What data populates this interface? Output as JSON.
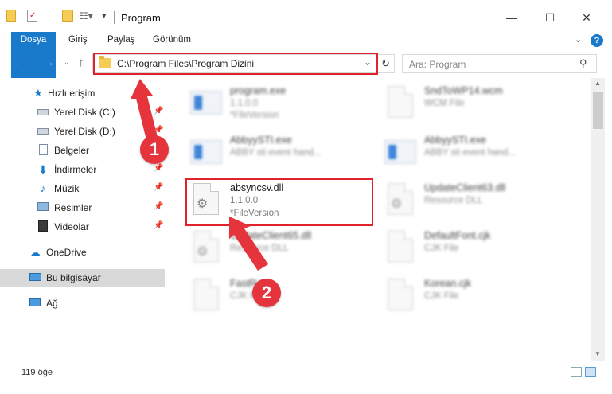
{
  "window": {
    "title": "Program",
    "buttons": {
      "minimize": "—",
      "maximize": "☐",
      "close": "✕"
    }
  },
  "ribbon": {
    "tabs": [
      "Dosya",
      "Giriş",
      "Paylaş",
      "Görünüm"
    ],
    "help": "?"
  },
  "address": {
    "path": "C:\\Program Files\\Program Dizini",
    "search_placeholder": "Ara: Program"
  },
  "sidebar": {
    "quick_access": "Hızlı erişim",
    "items": [
      {
        "label": "Yerel Disk (C:)",
        "icon": "drive-icon",
        "pinned": true
      },
      {
        "label": "Yerel Disk (D:)",
        "icon": "drive-icon",
        "pinned": true
      },
      {
        "label": "Belgeler",
        "icon": "documents-icon",
        "pinned": true
      },
      {
        "label": "İndirmeler",
        "icon": "download-icon",
        "pinned": true
      },
      {
        "label": "Müzik",
        "icon": "music-icon",
        "pinned": true
      },
      {
        "label": "Resimler",
        "icon": "pictures-icon",
        "pinned": true
      },
      {
        "label": "Videolar",
        "icon": "video-icon",
        "pinned": true
      }
    ],
    "onedrive": "OneDrive",
    "this_pc": "Bu bilgisayar",
    "network": "Ağ"
  },
  "files": [
    {
      "name": "program.exe",
      "line1": "1.1.0.0",
      "line2": "*FileVersion"
    },
    {
      "name": "SndToWP14.wcm",
      "line1": "WCM File",
      "line2": ""
    },
    {
      "name": "AbbyySTI.exe",
      "line1": "ABBY sti event hand...",
      "line2": ""
    },
    {
      "name": "AbbyySTI.exe",
      "line1": "ABBY sti event hand...",
      "line2": ""
    },
    {
      "name": "absyncsv.dll",
      "line1": "1.1.0.0",
      "line2": "*FileVersion"
    },
    {
      "name": "UpdateClient63.dll",
      "line1": "Resource DLL",
      "line2": ""
    },
    {
      "name": "UpdateClient65.dll",
      "line1": "Resource DLL",
      "line2": ""
    },
    {
      "name": "DefaultFont.cjk",
      "line1": "CJK File",
      "line2": ""
    },
    {
      "name": "FastRe...",
      "line1": "CJK File",
      "line2": ""
    },
    {
      "name": "Korean.cjk",
      "line1": "CJK File",
      "line2": ""
    }
  ],
  "status": {
    "item_count": "119 öğe"
  },
  "callouts": [
    "1",
    "2"
  ],
  "colors": {
    "accent": "#1979ca",
    "annotation_red": "#e0232a",
    "folder": "#f5cd56"
  }
}
